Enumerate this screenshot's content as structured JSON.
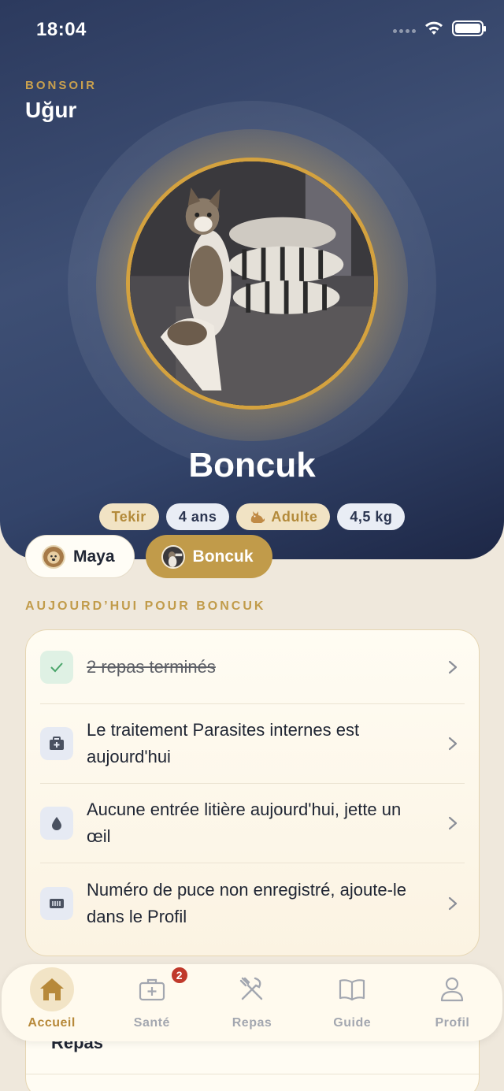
{
  "status_bar": {
    "time": "18:04"
  },
  "greeting": {
    "label": "BONSOIR",
    "name": "Uğur"
  },
  "pet": {
    "name": "Boncuk",
    "chips": [
      {
        "label": "Tekir",
        "style": "gold"
      },
      {
        "label": "4 ans",
        "style": "light"
      },
      {
        "label": "Adulte",
        "style": "gold",
        "icon": "cat-icon"
      },
      {
        "label": "4,5 kg",
        "style": "light"
      }
    ]
  },
  "pet_switcher": [
    {
      "label": "Maya",
      "active": false
    },
    {
      "label": "Boncuk",
      "active": true
    }
  ],
  "today": {
    "title": "AUJOURD’HUI POUR BONCUK",
    "items": [
      {
        "icon": "check-icon",
        "line1": "2 repas terminés",
        "line2": "",
        "done": true
      },
      {
        "icon": "medical-kit-icon",
        "line1": "Le traitement Parasites internes est",
        "line2": "aujourd'hui",
        "done": false
      },
      {
        "icon": "water-drop-icon",
        "line1": "Aucune entrée litière aujourd'hui, jette un",
        "line2": "œil",
        "done": false
      },
      {
        "icon": "chip-icon",
        "line1": "Numéro de puce non enregistré, ajoute-le",
        "line2": "dans le Profil",
        "done": false
      }
    ]
  },
  "next_card": {
    "label": "Repas"
  },
  "tabbar": {
    "tabs": [
      {
        "label": "Accueil",
        "icon": "home-icon",
        "active": true
      },
      {
        "label": "Santé",
        "icon": "health-icon",
        "badge": "2"
      },
      {
        "label": "Repas",
        "icon": "utensils-icon"
      },
      {
        "label": "Guide",
        "icon": "book-icon"
      },
      {
        "label": "Profil",
        "icon": "profile-icon"
      }
    ]
  },
  "colors": {
    "accent": "#c19b4a",
    "hero": "#34456b",
    "background": "#efe8dc",
    "badge": "#c0392b"
  }
}
